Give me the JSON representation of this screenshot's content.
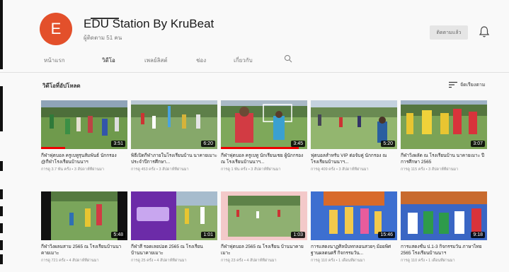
{
  "channel": {
    "avatar_letter": "E",
    "name": "EDU Station By KruBeat",
    "subscribers": "ผู้ติดตาม 51 คน",
    "subscribe_label": "ติดตามแล้ว"
  },
  "tabs": [
    {
      "label": "หน้าแรก"
    },
    {
      "label": "วิดีโอ",
      "active": true
    },
    {
      "label": "เพลย์ลิสต์"
    },
    {
      "label": "ช่อง"
    },
    {
      "label": "เกี่ยวกับ"
    }
  ],
  "section": {
    "title": "วิดีโอที่อัปโหลด",
    "sort_label": "จัดเรียงตาม"
  },
  "icons": {
    "bell": "bell-icon",
    "search": "search-icon",
    "sort": "sort-icon"
  },
  "videos": [
    {
      "title": "กีฬาฟุตบอล ครูเบทูรุนสัมพันธ์ นักกรอง @กีฬาโรงเรียนบ้านนาฯ",
      "meta": "การดู 3.7 พัน ครั้ง • 3 สัปดาห์ที่ผ่านมา",
      "duration": "3:51",
      "progress": 0.28
    },
    {
      "title": "พิธีเปิดกีฬาภายในโรงเรียนบ้าน นาคายเมาะ ประจำปีการศึกษา...",
      "meta": "การดู 453 ครั้ง • 3 สัปดาห์ที่ผ่านมา",
      "duration": "6:20",
      "progress": 0
    },
    {
      "title": "กีฬาฟุตบอล ครูเบทู นักเรียนเชย ผู้นักกรอง ณ โรงเรียนบ้านนาฯ...",
      "meta": "การดู 1 พัน ครั้ง • 3 สัปดาห์ที่ผ่านมา",
      "duration": "3:45",
      "progress": 0.9
    },
    {
      "title": "ฟุตบอลสำหรับ VIP ต่อจับคู่ นักกรอง ณ โรงเรียนบ้านนาฯ...",
      "meta": "การดู 409 ครั้ง • 3 สัปดาห์ที่ผ่านมา",
      "duration": "5:20",
      "progress": 0
    },
    {
      "title": "กีฬาวิ่งผลัด ณ โรงเรียนบ้าน นาคายเมาะ ปีการศึกษา 2565",
      "meta": "การดู 115 ครั้ง • 3 สัปดาห์ที่ผ่านมา",
      "duration": "3:07",
      "progress": 0
    },
    {
      "title": "กีฬาวิ่งผลมสาม 2565 ณ โรงเรียนบ้านนาคายเมาะ",
      "meta": "การดู 721 ครั้ง • 4 สัปดาห์ที่ผ่านมา",
      "duration": "5:48",
      "progress": 0
    },
    {
      "title": "กีฬาสี รอดเลยปอด 2565 ณ โรงเรียนบ้านนาคายเมาะ",
      "meta": "การดู 25 ครั้ง • 4 สัปดาห์ที่ผ่านมา",
      "duration": "1:01",
      "progress": 0
    },
    {
      "title": "กีฬาฟุตบอล 2565 ณ โรงเรียน บ้านนาคายเมาะ",
      "meta": "การดู 23 ครั้ง • 4 สัปดาห์ที่ผ่านมา",
      "duration": "1:03",
      "progress": 0
    },
    {
      "title": "การแสดงนาฏศิลป์บทกลอนสวยๆ ม้อยพิศฐานผลดนตรี กิจกรรมวัน...",
      "meta": "การดู 110 ครั้ง • 1 เดือนที่ผ่านมา",
      "duration": "15:46",
      "progress": 0
    },
    {
      "title": "การแสดงชั้น ป.1-3 กิจกรรมวัน ภาษาไทย 2565 โรงเรียนบ้านนาฯ",
      "meta": "การดู 110 ครั้ง • 1 เดือนที่ผ่านมา",
      "duration": "9:18",
      "progress": 0
    }
  ]
}
